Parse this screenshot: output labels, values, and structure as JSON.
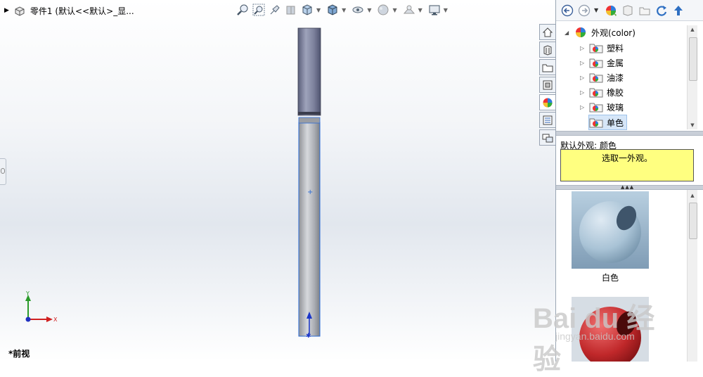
{
  "header": {
    "title": "零件1  (默认<<默认>_显..."
  },
  "heads_up_toolbar": {
    "icons": [
      "zoom-to-fit-icon",
      "zoom-to-area-icon",
      "previous-view-icon",
      "section-view-icon",
      "view-orientation-icon",
      "display-style-icon",
      "hide-show-icon",
      "edit-appearance-icon",
      "apply-scene-icon",
      "view-settings-icon"
    ]
  },
  "viewport": {
    "view_label": "*前视",
    "triad": {
      "x_label": "X",
      "y_label": "Y"
    }
  },
  "taskpane": {
    "toolbar_icons": [
      "back-icon",
      "forward-icon",
      "home-icon",
      "appearance-icon",
      "add-folder-icon",
      "refresh-icon",
      "up-icon"
    ],
    "side_tabs": [
      "home-tab-icon",
      "design-library-tab-icon",
      "file-explorer-tab-icon",
      "view-palette-tab-icon",
      "appearances-tab-icon",
      "custom-properties-tab-icon",
      "forum-tab-icon"
    ],
    "tree": {
      "root": "外观(color)",
      "items": [
        {
          "label": "塑料"
        },
        {
          "label": "金属"
        },
        {
          "label": "油漆"
        },
        {
          "label": "橡胶"
        },
        {
          "label": "玻璃"
        },
        {
          "label": "单色"
        }
      ],
      "selected": "单色"
    },
    "default_appearance_label": "默认外观: 颜色",
    "hint": "选取一外观。",
    "swatches": [
      {
        "label": "白色",
        "color": "#a9c3d6"
      },
      {
        "label": "",
        "color": "#c0282a"
      }
    ]
  },
  "watermark": {
    "main": "Bai du 经验",
    "sub": "jingyan.baidu.com"
  },
  "colors": {
    "accent": "#2a6bd6",
    "hint_bg": "#ffff80",
    "pen_cap": "#7a7f99",
    "pen_body": "#b3b6bc"
  }
}
